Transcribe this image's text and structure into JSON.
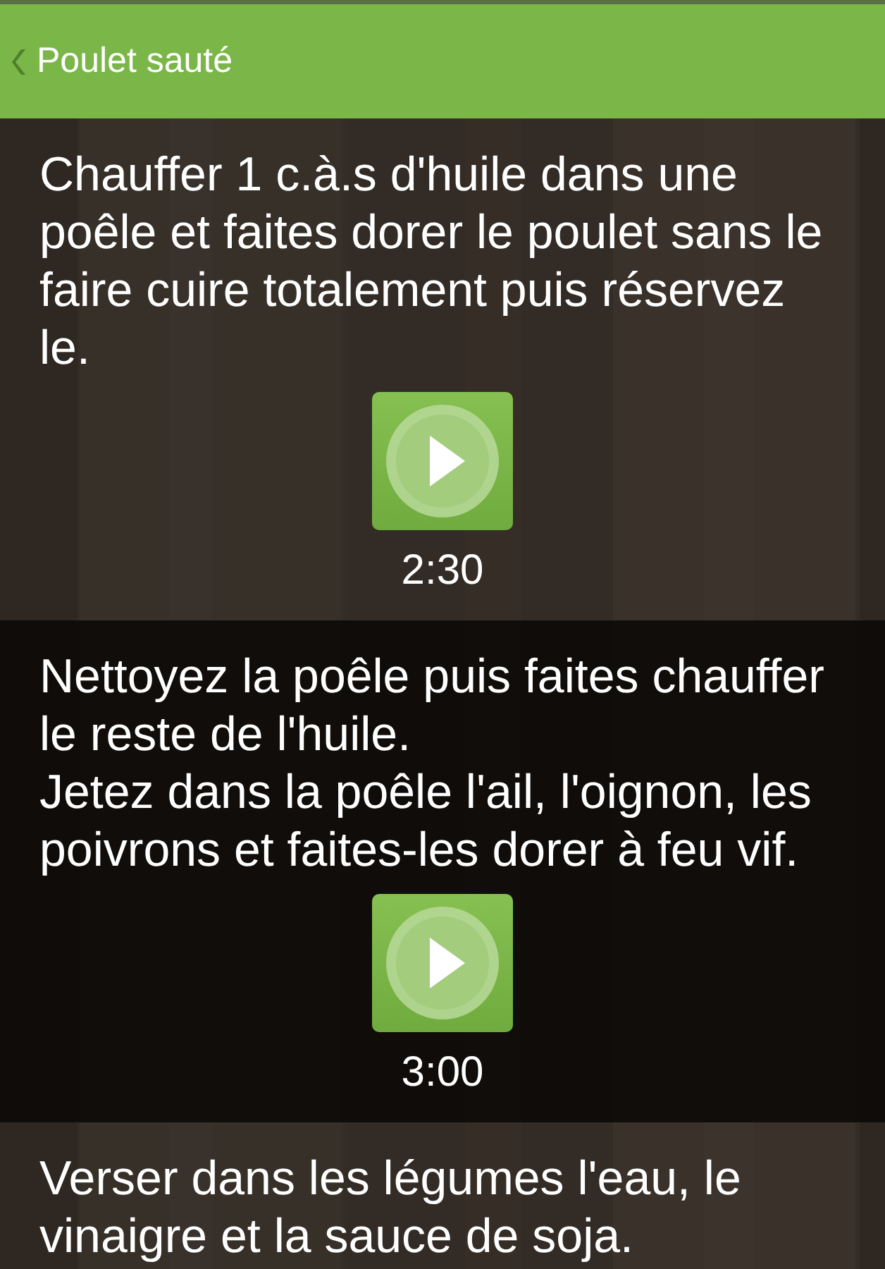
{
  "header": {
    "title": "Poulet sauté"
  },
  "steps": [
    {
      "text": "Chauffer 1 c.à.s d'huile dans une poêle et faites dorer le poulet sans le faire cuire totalement puis réservez le.",
      "shaded": false,
      "timer": "2:30"
    },
    {
      "text": "Nettoyez la poêle puis faites chauffer le reste de l'huile.\nJetez dans la poêle l'ail, l'oignon, les poivrons et faites-les dorer à feu vif.",
      "shaded": true,
      "timer": "3:00"
    },
    {
      "text": "Verser dans les légumes l'eau, le vinaigre et la sauce de soja.",
      "shaded": false
    }
  ]
}
